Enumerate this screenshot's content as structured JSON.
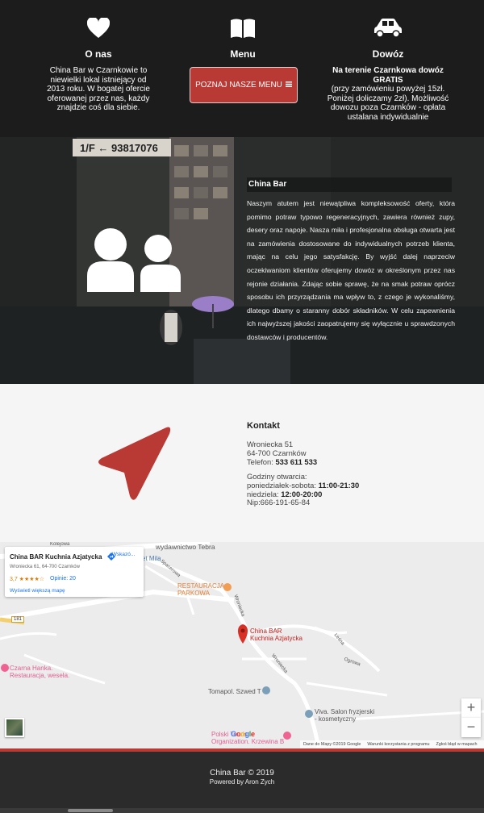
{
  "features": {
    "about": {
      "title": "O nas",
      "text": "China Bar w Czarnkowie to niewielki lokal istniejący od 2013 roku. W bogatej ofercie oferowanej przez nas, każdy znajdzie coś dla siebie.",
      "icon": "heart-icon"
    },
    "menu": {
      "title": "Menu",
      "button_label": "POZNAJ NASZE MENU",
      "button_icon": "bars-icon",
      "icon": "book-icon",
      "button_color": "#b93a35"
    },
    "delivery": {
      "title": "Dowóz",
      "bold_text": "Na terenie Czarnkowa dowóz GRATIS",
      "text": "(przy zamówieniu powyżej 15zł. Poniżej doliczamy 2zł). Możliwość dowozu poza Czarnków - opłata ustalana indywidualnie",
      "icon": "car-icon"
    }
  },
  "hero": {
    "sign_text": "1/F ← 93817076",
    "icon": "users-icon",
    "about_title": "China Bar",
    "about_text": "Naszym atutem jest niewątpliwa kompleksowość oferty, która pomimo potraw typowo regeneracyjnych, zawiera również zupy, desery oraz napoje. Nasza miła i profesjonalna obsługa otwarta jest na zamówienia dostosowane do indywidualnych potrzeb klienta, mając na celu jego satysfakcję. By wyjść dalej naprzeciw oczekiwaniom klientów oferujemy dowóz w określonym przez nas rejonie działania. Zdając sobie sprawę, że na smak potraw oprócz sposobu ich przyrządzania ma wpływ to, z czego je wykonaliśmy, dlatego dbamy o staranny dobór składników. W celu zapewnienia ich najwyższej jakości zaopatrujemy się wyłącznie u sprawdzonych dostawców i producentów."
  },
  "contact": {
    "icon": "location-arrow-icon",
    "title": "Kontakt",
    "street": "Wroniecka 51",
    "city": "64-700 Czarnków",
    "phone_label": "Telefon:",
    "phone": "533 611 533",
    "hours_title": "Godziny otwarcia:",
    "weekdays_label": "poniedziałek-sobota:",
    "weekdays_hours": "11:00-21:30",
    "sunday_label": "niedziela:",
    "sunday_hours": "12:00-20:00",
    "nip": "Nip:666-191-65-84",
    "accent_color": "#b93a35"
  },
  "map": {
    "card": {
      "name": "China BAR Kuchnia Azjatycka",
      "address": "Wroniecka 61, 64-700 Czarnków",
      "rating": "3,7 ★★★★☆",
      "reviews": "Opinie: 20",
      "larger_map": "Wyświetl większą mapę",
      "directions": "Wskazó..."
    },
    "labels": {
      "kolejowa": "Kolejowa",
      "tebra": "wydawnictwo Tebra",
      "mila": "et Mila",
      "spacerowa": "Spacerowa",
      "restauracja": "RESTAURACJA\nPARKOWA",
      "road_181": "181",
      "marker": "China BAR\nKuchnia Azjatycka",
      "hanka": "Czarna Hanka.\nRestauracja, wesela.",
      "szwed": "Tomapol. Szwed T",
      "viva": "Viva. Salon fryzjerski\n- kosmetyczny",
      "touristic": "Polski Touristic\nOrganization. Krzewina B",
      "wroniecka1": "Wroniecka",
      "wroniecka2": "Wroniecka",
      "lesna": "Leśna",
      "ogrowa": "Ogrowa",
      "google": "Google"
    },
    "attribution": {
      "data": "Dane do Mapy ©2019 Google",
      "terms": "Warunki korzystania z programu",
      "report": "Zgłoś błąd w mapach"
    },
    "zoom_in": "+",
    "zoom_out": "−"
  },
  "footer": {
    "copyright": "China Bar © 2019",
    "powered": "Powered by Aron Zych"
  }
}
